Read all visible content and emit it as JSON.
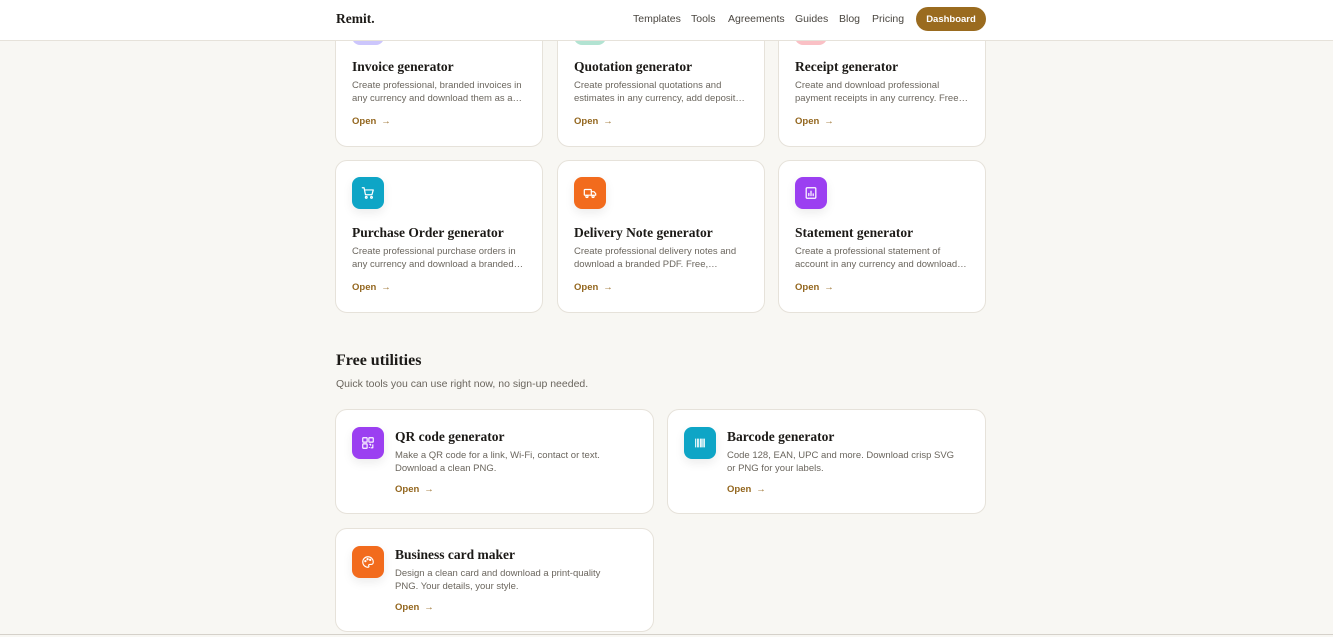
{
  "header": {
    "logo": "Remit.",
    "nav": [
      "Templates",
      "Tools",
      "Agreements",
      "Guides",
      "Blog",
      "Pricing"
    ],
    "dashboard_label": "Dashboard"
  },
  "generators": [
    {
      "title": "Invoice generator",
      "desc": "Create professional, branded invoices in any currency and download them as a…",
      "open": "Open",
      "icon": "invoice-icon",
      "color": "#6d5bf5"
    },
    {
      "title": "Quotation generator",
      "desc": "Create professional quotations and estimates in any currency, add deposit…",
      "open": "Open",
      "icon": "quotation-icon",
      "color": "#22b07d"
    },
    {
      "title": "Receipt generator",
      "desc": "Create and download professional payment receipts in any currency. Free…",
      "open": "Open",
      "icon": "receipt-icon",
      "color": "#f04a5a"
    },
    {
      "title": "Purchase Order generator",
      "desc": "Create professional purchase orders in any currency and download a branded…",
      "open": "Open",
      "icon": "cart-icon",
      "color": "#0ea5c6"
    },
    {
      "title": "Delivery Note generator",
      "desc": "Create professional delivery notes and download a branded PDF. Free,…",
      "open": "Open",
      "icon": "truck-icon",
      "color": "#f26b1d"
    },
    {
      "title": "Statement generator",
      "desc": "Create a professional statement of account in any currency and download…",
      "open": "Open",
      "icon": "chart-icon",
      "color": "#9b3ff1"
    }
  ],
  "utilities": {
    "title": "Free utilities",
    "subtitle": "Quick tools you can use right now, no sign-up needed.",
    "items": [
      {
        "title": "QR code generator",
        "desc": "Make a QR code for a link, Wi-Fi, contact or text. Download a clean PNG.",
        "open": "Open",
        "icon": "qr-code-icon",
        "color": "#9b3ff1"
      },
      {
        "title": "Barcode generator",
        "desc": "Code 128, EAN, UPC and more. Download crisp SVG or PNG for your labels.",
        "open": "Open",
        "icon": "barcode-icon",
        "color": "#0ea5c6"
      },
      {
        "title": "Business card maker",
        "desc": "Design a clean card and download a print-quality PNG. Your details, your style.",
        "open": "Open",
        "icon": "palette-icon",
        "color": "#f26b1d"
      }
    ]
  },
  "colors": {
    "accent": "#9a6b1f",
    "background": "#f8f7f3",
    "link": "#93661e"
  }
}
